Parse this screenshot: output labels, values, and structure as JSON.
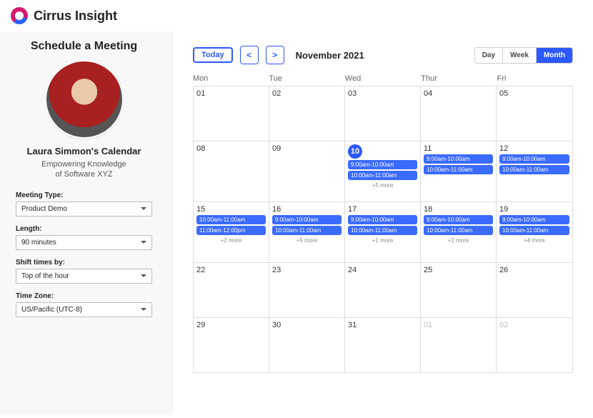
{
  "header": {
    "title": "Cirrus Insight"
  },
  "sidebar": {
    "title": "Schedule a Meeting",
    "person_name": "Laura Simmon's Calendar",
    "person_sub1": "Empowering Knowledge",
    "person_sub2": "of Software XYZ",
    "fields": {
      "meeting_type_label": "Meeting Type:",
      "meeting_type_value": "Product Demo",
      "length_label": "Length:",
      "length_value": "90 minutes",
      "shift_label": "Shift times by:",
      "shift_value": "Top of the hour",
      "timezone_label": "Time Zone:",
      "timezone_value": "US/Pacific (UTC-8)"
    }
  },
  "calendar": {
    "today_label": "Today",
    "month_title": "November 2021",
    "views": {
      "day": "Day",
      "week": "Week",
      "month": "Month"
    },
    "weekdays": [
      "Mon",
      "Tue",
      "Wed",
      "Thur",
      "Fri"
    ],
    "weeks": [
      [
        {
          "n": "01"
        },
        {
          "n": "02"
        },
        {
          "n": "03"
        },
        {
          "n": "04"
        },
        {
          "n": "05"
        }
      ],
      [
        {
          "n": "08"
        },
        {
          "n": "09"
        },
        {
          "n": "10",
          "today": true,
          "events": [
            "9:00am-10:00am",
            "10:00am-11:00am"
          ],
          "more": "+5 more"
        },
        {
          "n": "11",
          "events": [
            "9:00am-10:00am",
            "10:00am-11:00am"
          ]
        },
        {
          "n": "12",
          "events": [
            "9:00am-10:00am",
            "10:00am-11:00am"
          ]
        }
      ],
      [
        {
          "n": "15",
          "events": [
            "10:00am-11:00am",
            "11:00am-12:00pm"
          ],
          "more": "+2 more"
        },
        {
          "n": "16",
          "events": [
            "9:00am-10:00am",
            "10:00am-11:00am"
          ],
          "more": "+5 more"
        },
        {
          "n": "17",
          "events": [
            "9:00am-10:00am",
            "10:00am-11:00am"
          ],
          "more": "+1 more"
        },
        {
          "n": "18",
          "events": [
            "9:00am-10:00am",
            "10:00am-11:00am"
          ],
          "more": "+2 more"
        },
        {
          "n": "19",
          "events": [
            "9:00am-10:00am",
            "10:00am-11:00am"
          ],
          "more": "+4 more"
        }
      ],
      [
        {
          "n": "22"
        },
        {
          "n": "23"
        },
        {
          "n": "24"
        },
        {
          "n": "25"
        },
        {
          "n": "26"
        }
      ],
      [
        {
          "n": "29"
        },
        {
          "n": "30"
        },
        {
          "n": "31"
        },
        {
          "n": "01",
          "other": true
        },
        {
          "n": "02",
          "other": true
        }
      ]
    ]
  }
}
